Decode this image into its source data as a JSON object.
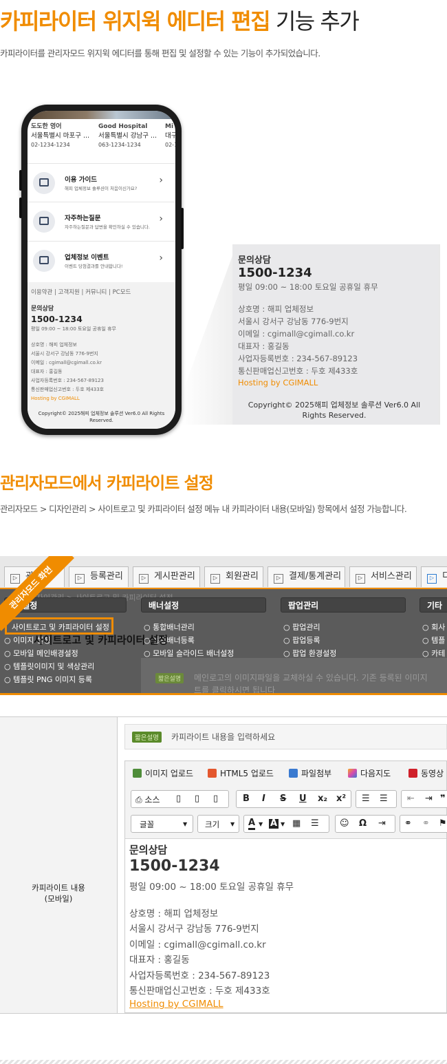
{
  "section1": {
    "title_highlight": "카피라이터 위지윅 에디터 편집",
    "title_rest": " 기능 추가",
    "description": "카피라이터를 관리자모드 위지윅 에디터를 통해 편집 및 설정할 수 있는 기능이 추가되었습니다."
  },
  "phone": {
    "hospitals": [
      {
        "name": "도도한 영어",
        "address": "서울특별시 마포구 ...",
        "tel": "02-1234-1234"
      },
      {
        "name": "Good Hospital",
        "address": "서울특별시 강남구 ...",
        "tel": "063-1234-1234"
      },
      {
        "name": "Mi",
        "address": "대구",
        "tel": "02-1"
      }
    ],
    "menu": [
      {
        "title": "이용 가이드",
        "desc": "해피 업체정보 솔루션이 처음이신가요?"
      },
      {
        "title": "자주하는질문",
        "desc": "자주하는질문과 답변을 확인하실 수 있습니다."
      },
      {
        "title": "업체정보 이벤트",
        "desc": "이벤트 당첨결과를 안내합니다!"
      }
    ],
    "footer_links": "이용약관 | 고객지원 | 커뮤니티 | PC모드",
    "footer": {
      "title": "문의상담",
      "phone": "1500-1234",
      "hours": "평일 09:00 ~ 18:00 토요일 공휴일 휴무",
      "company": "상호명 : 해피 업체정보",
      "address": "서울시 강서구 강남동 776-9번지",
      "email": "이메일 : cgimall@cgimall.co.kr",
      "ceo": "대표자 : 홍길동",
      "biz_no": "사업자등록번호 : 234-567-89123",
      "mail_order": "통신판매업신고번호 : 두호 제433호",
      "hosting": "Hosting by CGIMALL",
      "copyright": "Copyright© 2025해피 업체정보 솔루션 Ver6.0 All Rights Reserved."
    }
  },
  "callout": {
    "title": "문의상담",
    "phone": "1500-1234",
    "hours": "평일 09:00 ~ 18:00 토요일 공휴일 휴무",
    "company": "상호명 : 해피 업체정보",
    "address": "서울시 강서구 강남동 776-9번지",
    "email": "이메일 : cgimall@cgimall.co.kr",
    "ceo": "대표자 : 홍길동",
    "biz_no": "사업자등록번호 : 234-567-89123",
    "mail_order": "통신판매업신고번호 : 두호 제433호",
    "hosting": "Hosting by CGIMALL",
    "copyright": "Copyright© 2025해피 업체정보 솔루션 Ver6.0 All Rights Reserved."
  },
  "section2": {
    "title": "관리자모드에서 카피라이트 설정",
    "description": "관리자모드 > 디자인관리 > 사이트로고 및 카피라이터 설정 메뉴 내 카피라이터 내용(모바일) 항목에서 설정 가능합니다."
  },
  "admin": {
    "ribbon": "관리자모드 화면",
    "tabs": [
      "관리",
      "등록관리",
      "게시판관리",
      "회원관리",
      "결제/통계관리",
      "서비스관리",
      "디"
    ],
    "breadcrumb": "> 디자인관리 > 사이트로고 및 카피라이터 설정",
    "headers": [
      "인 설정",
      "배너설정",
      "팝업관리",
      "기타"
    ],
    "col1": [
      "사이트로고 및 카피라이터 설정",
      "이미지 설정",
      "모바일 메인배경설정",
      "템플릿이미지 및 색상관리",
      "템플릿 PNG 이미지 등록"
    ],
    "col2": [
      "통합배너관리",
      "통합배너등록",
      "모바일 슬라이드 배너설정"
    ],
    "col3": [
      "팝업관리",
      "팝업등록",
      "팝업 환경설정"
    ],
    "col4": [
      "회사",
      "템플",
      "카테"
    ],
    "page_title": "사이트로고 및 카피라이터 설정",
    "badge": "짧은설명",
    "note": "메인로고의 이미지파일을 교체하실 수 있습니다. 기존 등록된 이미지",
    "note2": "트를 클릭하시면 됩니다"
  },
  "editor_form": {
    "label_line1": "카피라이트 내용",
    "label_line2": "(모바일)",
    "short_badge": "짧은설명",
    "short_text": "카피라이트 내용을 입력하세요",
    "tools_row1": [
      "이미지 업로드",
      "HTML5 업로드",
      "파일첨부",
      "다음지도",
      "동영상"
    ],
    "source_label": "소스",
    "font_label": "글꼴",
    "size_label": "크기",
    "content": {
      "title": "문의상담",
      "phone": "1500-1234",
      "hours": "평일 09:00 ~ 18:00 토요일 공휴일 휴무",
      "company": "상호명 : 해피 업체정보",
      "address": "서울시 강서구 강남동 776-9번지",
      "email": "이메일 : cgimall@cgimall.co.kr",
      "ceo": "대표자 : 홍길동",
      "biz_no": "사업자등록번호 : 234-567-89123",
      "mail_order": "통신판매업신고번호 : 두호 제433호",
      "hosting": "Hosting by CGIMALL"
    }
  },
  "colors": {
    "accent": "#f08c00",
    "dark": "#222222"
  }
}
